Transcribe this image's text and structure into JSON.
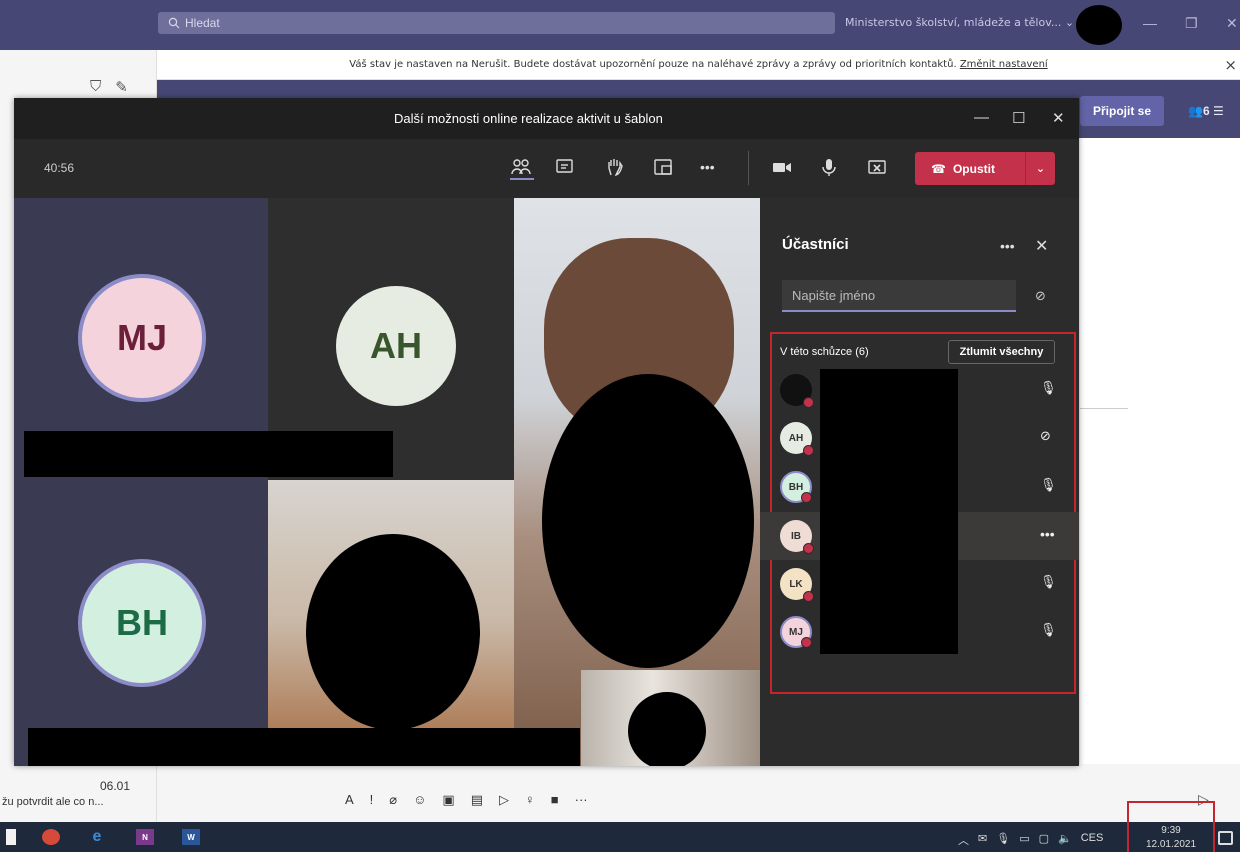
{
  "teams": {
    "search_placeholder": "Hledat",
    "org_name": "Ministerstvo školství, mládeže a tělov...",
    "notice_text": "Váš stav je nastaven na Nerušit. Budete dostávat upozornění pouze na naléhavé zprávy a zprávy od prioritních kontaktů.",
    "notice_link": "Změnit nastavení",
    "join_button": "Připojit se",
    "participant_count": "6",
    "chat_time": "06.01",
    "chat_preview": "žu potvrdit ale co n..."
  },
  "meeting": {
    "title": "Další možnosti online realizace aktivit u šablon",
    "timer": "40:56",
    "leave_label": "Opustit",
    "tiles": [
      {
        "initials": "MJ",
        "bg": "#f4d3dc",
        "fg": "#6b1f3a"
      },
      {
        "initials": "AH",
        "bg": "#e6ece1",
        "fg": "#39552c"
      },
      {
        "initials": "BH",
        "bg": "#d3efe0",
        "fg": "#1d6b45"
      }
    ]
  },
  "participants": {
    "title": "Účastníci",
    "search_placeholder": "Napište jméno",
    "section_label": "V této schůzce (6)",
    "mute_all_label": "Ztlumit všechny",
    "rows": [
      {
        "initials": "",
        "mic": "on"
      },
      {
        "initials": "AH",
        "mic": "off"
      },
      {
        "initials": "BH",
        "mic": "on"
      },
      {
        "initials": "IB",
        "mic": "more"
      },
      {
        "initials": "LK",
        "mic": "on"
      },
      {
        "initials": "MJ",
        "mic": "on"
      }
    ]
  },
  "taskbar": {
    "time": "9:39",
    "date": "12.01.2021",
    "lang": "CES"
  },
  "colors": {
    "teams_purple": "#464775",
    "leave_red": "#c4314b",
    "highlight_red": "#c4262e"
  }
}
